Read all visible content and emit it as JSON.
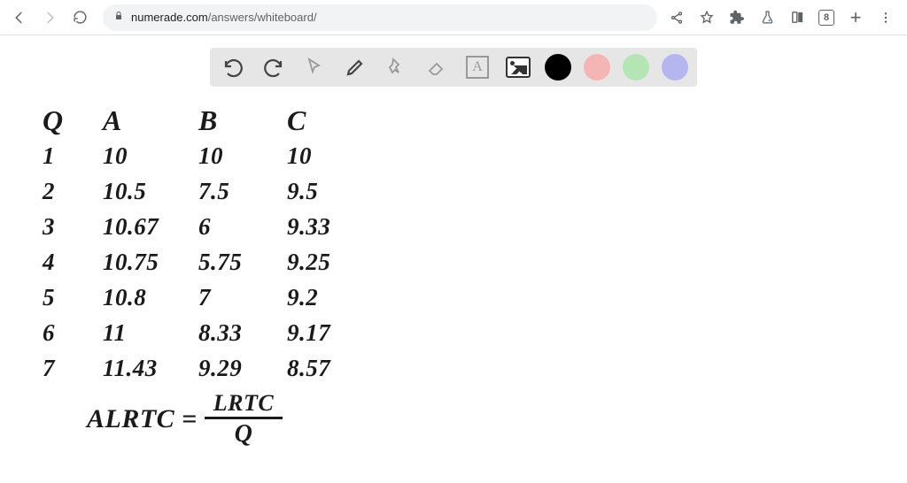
{
  "browser": {
    "url_domain": "numerade.com",
    "url_path": "/answers/whiteboard/",
    "tab_count": "8"
  },
  "toolbar": {
    "text_tool_label": "A"
  },
  "table": {
    "headers": {
      "q": "Q",
      "a": "A",
      "b": "B",
      "c": "C"
    },
    "rows": [
      {
        "q": "1",
        "a": "10",
        "b": "10",
        "c": "10"
      },
      {
        "q": "2",
        "a": "10.5",
        "b": "7.5",
        "c": "9.5"
      },
      {
        "q": "3",
        "a": "10.67",
        "b": "6",
        "c": "9.33"
      },
      {
        "q": "4",
        "a": "10.75",
        "b": "5.75",
        "c": "9.25"
      },
      {
        "q": "5",
        "a": "10.8",
        "b": "7",
        "c": "9.2"
      },
      {
        "q": "6",
        "a": "11",
        "b": "8.33",
        "c": "9.17"
      },
      {
        "q": "7",
        "a": "11.43",
        "b": "9.29",
        "c": "8.57"
      }
    ]
  },
  "formula": {
    "lhs": "ALRTC =",
    "numerator": "LRTC",
    "denominator": "Q"
  }
}
